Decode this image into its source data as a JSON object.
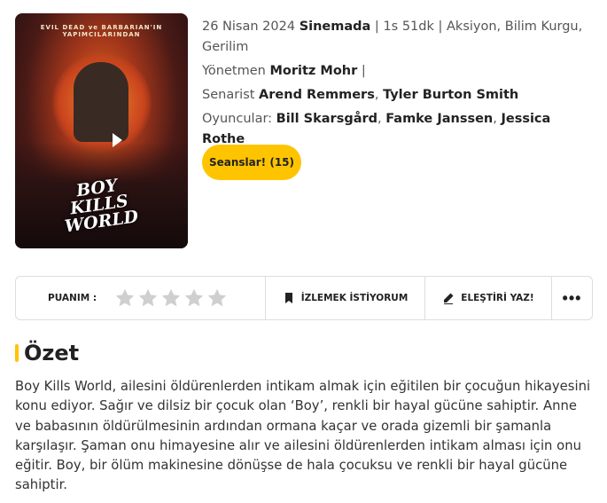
{
  "poster": {
    "tagline": "EVIL DEAD ve BARBARIAN'IN YAPIMCILARINDAN",
    "title_logo": "BOY KILLS WORLD",
    "play_icon": "play-icon"
  },
  "info": {
    "date": "26 Nisan 2024",
    "status": "Sinemada",
    "duration": "1s 51dk",
    "genres": "Aksiyon, Bilim Kurgu, Gerilim",
    "director_label": "Yönetmen",
    "director": "Moritz Mohr",
    "writer_label": "Senarist",
    "writers": [
      "Arend Remmers",
      "Tyler Burton Smith"
    ],
    "cast_label": "Oyuncular:",
    "cast": [
      "Bill Skarsgård",
      "Famke Janssen",
      "Jessica Rothe"
    ]
  },
  "seans_button": "Seanslar! (15)",
  "action_bar": {
    "rating_label": "PUANIM :",
    "stars": 5,
    "rating_value": 0,
    "watchlist_label": "İZLEMEK İSTİYORUM",
    "review_label": "ELEŞTİRİ YAZ!",
    "more_label": "•••"
  },
  "summary": {
    "title": "Özet",
    "text": "Boy Kills World, ailesini öldürenlerden intikam almak için eğitilen bir çocuğun hikayesini konu ediyor. Sağır ve dilsiz bir çocuk olan ‘Boy’, renkli bir hayal gücüne sahiptir. Anne ve babasının öldürülmesinin ardından ormana kaçar ve orada gizemli bir şamanla karşılaşır.  Şaman onu himayesine alır ve ailesini öldürenlerden intikam alması için onu eğitir. Boy, bir ölüm makinesine dönüşse de hala çocuksu ve renkli bir hayal gücüne sahiptir."
  },
  "colors": {
    "accent": "#ffc400",
    "star_empty": "#cfcfcf"
  }
}
